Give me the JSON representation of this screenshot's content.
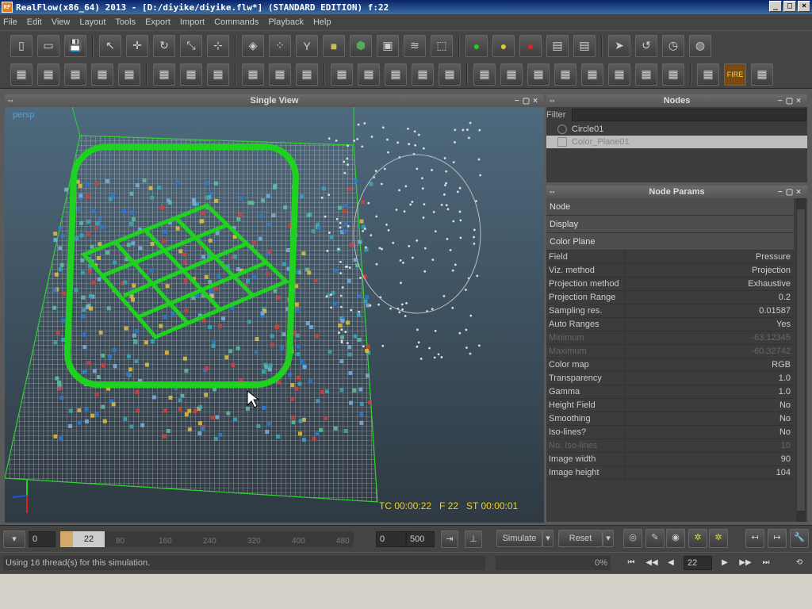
{
  "window": {
    "title": "RealFlow(x86_64) 2013 - [D:/diyike/diyike.flw*] (STANDARD EDITION) f:22",
    "logo": "RF",
    "min": "_",
    "max": "□",
    "close": "×"
  },
  "menu": [
    "File",
    "Edit",
    "View",
    "Layout",
    "Tools",
    "Export",
    "Import",
    "Commands",
    "Playback",
    "Help"
  ],
  "toolbar1_icons": [
    "new-file-icon",
    "open-file-icon",
    "save-icon",
    "select-icon",
    "move-icon",
    "rotate-icon",
    "scale-icon",
    "axis-icon",
    "emitter-icon",
    "particles-icon",
    "daemon-icon",
    "object-icon",
    "mesh-icon",
    "camera-icon",
    "wave-icon",
    "cube-icon",
    "green-circle-icon",
    "yellow-circle-icon",
    "red-circle-icon",
    "save-green-icon",
    "save-red-icon",
    "play-simulate-icon",
    "reset-icon",
    "clock-icon",
    "globe-icon"
  ],
  "toolbar2_icons": [
    "list-icon",
    "plus-icon",
    "connect-icon",
    "add-icon",
    "search-icon",
    "box-icon",
    "box2-icon",
    "export-icon",
    "film-icon",
    "ruler-icon",
    "dots-icon",
    "grid1-icon",
    "grid2-icon",
    "grid3-icon",
    "grid4-icon",
    "hourglass-icon",
    "cube-a-icon",
    "cube-b-icon",
    "cube-c-icon",
    "cube-d-icon",
    "cube-e-icon",
    "cube-f-icon",
    "cube-g-icon",
    "cube-h-icon",
    "render-icon",
    "fire-icon",
    "camera2-icon"
  ],
  "fire_label": "FIRE",
  "viewport": {
    "title": "Single View",
    "camera_label": "persp",
    "hud": "TC 00:00:22   F 22   ST 00:00:01"
  },
  "nodes": {
    "title": "Nodes",
    "filter_label": "Filter",
    "items": [
      {
        "label": "Circle01"
      },
      {
        "label": "Color_Plane01"
      }
    ]
  },
  "params": {
    "title": "Node Params",
    "sections": [
      "Node",
      "Display",
      "Color Plane"
    ],
    "rows": [
      {
        "k": "Field",
        "v": "Pressure"
      },
      {
        "k": "Viz. method",
        "v": "Projection"
      },
      {
        "k": "Projection method",
        "v": "Exhaustive"
      },
      {
        "k": "Projection Range",
        "v": "0.2"
      },
      {
        "k": "Sampling res.",
        "v": "0.01587"
      },
      {
        "k": "Auto Ranges",
        "v": "Yes"
      },
      {
        "k": "Minimum",
        "v": "-63.12345"
      },
      {
        "k": "Maximum",
        "v": "-60.32742"
      },
      {
        "k": "Color map",
        "v": "RGB"
      },
      {
        "k": "Transparency",
        "v": "1.0"
      },
      {
        "k": "Gamma",
        "v": "1.0"
      },
      {
        "k": "Height Field",
        "v": "No"
      },
      {
        "k": "Smoothing",
        "v": "No"
      },
      {
        "k": "Iso-lines?",
        "v": "No"
      },
      {
        "k": "No. Iso-lines",
        "v": "10"
      },
      {
        "k": "Image width",
        "v": "90"
      },
      {
        "k": "Image height",
        "v": "104"
      }
    ]
  },
  "timeline": {
    "start": "0",
    "current": "22",
    "ticks": [
      "80",
      "160",
      "240",
      "320",
      "400",
      "480"
    ],
    "range_start": "0",
    "range_end": "500",
    "simulate": "Simulate",
    "reset": "Reset"
  },
  "status": {
    "text": "Using 16 thread(s) for this simulation.",
    "progress": "0%",
    "frame": "22"
  },
  "colors": {
    "accent_green": "#1fd21f",
    "hud_yellow": "#f0d020",
    "persp_blue": "#5aa0d8"
  }
}
